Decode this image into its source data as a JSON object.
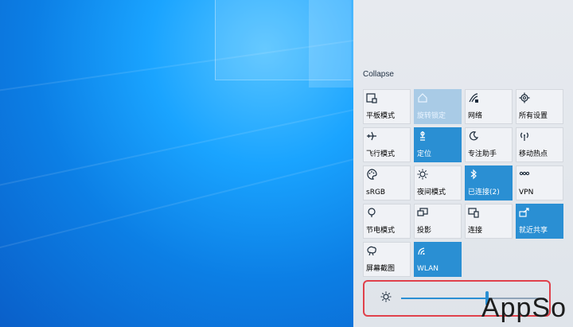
{
  "action_center": {
    "collapse_label": "Collapse",
    "tiles": [
      {
        "label": "平板模式",
        "icon": "tablet-icon",
        "state": "off"
      },
      {
        "label": "旋转锁定",
        "icon": "rotation-lock-icon",
        "state": "disabled"
      },
      {
        "label": "网络",
        "icon": "network-icon",
        "state": "off"
      },
      {
        "label": "所有设置",
        "icon": "settings-icon",
        "state": "off"
      },
      {
        "label": "飞行模式",
        "icon": "airplane-icon",
        "state": "off"
      },
      {
        "label": "定位",
        "icon": "location-icon",
        "state": "on"
      },
      {
        "label": "专注助手",
        "icon": "moon-icon",
        "state": "off"
      },
      {
        "label": "移动热点",
        "icon": "hotspot-icon",
        "state": "off"
      },
      {
        "label": "sRGB",
        "icon": "palette-icon",
        "state": "off"
      },
      {
        "label": "夜间模式",
        "icon": "night-light-icon",
        "state": "off"
      },
      {
        "label": "已连接(2)",
        "icon": "bluetooth-icon",
        "state": "on"
      },
      {
        "label": "VPN",
        "icon": "vpn-icon",
        "state": "off"
      },
      {
        "label": "节电模式",
        "icon": "battery-saver-icon",
        "state": "off"
      },
      {
        "label": "投影",
        "icon": "project-icon",
        "state": "off"
      },
      {
        "label": "连接",
        "icon": "connect-icon",
        "state": "off"
      },
      {
        "label": "就近共享",
        "icon": "nearby-share-icon",
        "state": "on"
      },
      {
        "label": "屏幕截图",
        "icon": "screenshot-icon",
        "state": "off"
      },
      {
        "label": "WLAN",
        "icon": "wifi-icon",
        "state": "on"
      }
    ]
  },
  "brightness": {
    "icon": "sun-icon",
    "level": 0.6
  },
  "watermark": "AppSo",
  "colors": {
    "accent": "#2a8fd3",
    "tile": "#f0f2f6",
    "highlight": "#e0414b"
  }
}
